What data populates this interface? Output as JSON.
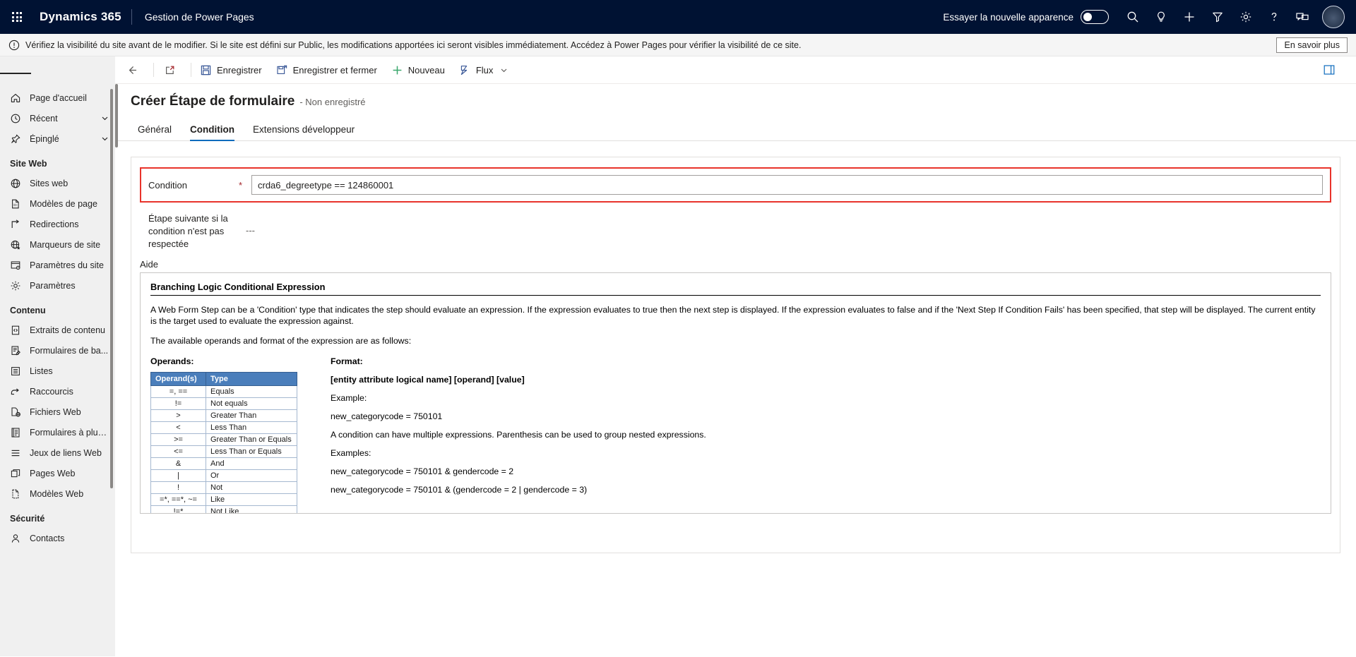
{
  "topnav": {
    "waffle_icon": "app-launcher-icon",
    "brand": "Dynamics 365",
    "app_name": "Gestion de Power Pages",
    "new_look_label": "Essayer la nouvelle apparence",
    "new_look_state": "off",
    "icons": [
      {
        "name": "search-icon"
      },
      {
        "name": "lightbulb-icon"
      },
      {
        "name": "plus-icon"
      },
      {
        "name": "filter-icon"
      },
      {
        "name": "gear-icon"
      },
      {
        "name": "help-question-icon"
      },
      {
        "name": "feedback-chat-icon"
      }
    ],
    "avatar": "user-avatar"
  },
  "notification": {
    "icon": "warning-circle-icon",
    "text": "Vérifiez la visibilité du site avant de le modifier. Si le site est défini sur Public, les modifications apportées ici seront visibles immédiatement. Accédez à Power Pages pour vérifier la visibilité de ce site.",
    "action_label": "En savoir plus"
  },
  "sidebar": {
    "hamburger": "site-map-toggle",
    "top_items": [
      {
        "label": "Page d'accueil",
        "icon": "home-icon",
        "chevron": false
      },
      {
        "label": "Récent",
        "icon": "clock-icon",
        "chevron": true
      },
      {
        "label": "Épinglé",
        "icon": "pin-icon",
        "chevron": true
      }
    ],
    "groups": [
      {
        "title": "Site Web",
        "items": [
          {
            "label": "Sites web",
            "icon": "globe-icon"
          },
          {
            "label": "Modèles de page",
            "icon": "page-template-icon"
          },
          {
            "label": "Redirections",
            "icon": "redirect-arrow-icon"
          },
          {
            "label": "Marqueurs de site",
            "icon": "globe-star-icon"
          },
          {
            "label": "Paramètres du site",
            "icon": "site-settings-icon"
          },
          {
            "label": "Paramètres",
            "icon": "gear-icon"
          }
        ]
      },
      {
        "title": "Contenu",
        "items": [
          {
            "label": "Extraits de contenu",
            "icon": "code-snippet-icon"
          },
          {
            "label": "Formulaires de ba...",
            "icon": "form-edit-icon"
          },
          {
            "label": "Listes",
            "icon": "list-icon"
          },
          {
            "label": "Raccourcis",
            "icon": "shortcut-icon"
          },
          {
            "label": "Fichiers Web",
            "icon": "web-file-icon"
          },
          {
            "label": "Formulaires à plus...",
            "icon": "multistep-form-icon"
          },
          {
            "label": "Jeux de liens Web",
            "icon": "link-set-icon"
          },
          {
            "label": "Pages Web",
            "icon": "web-pages-icon"
          },
          {
            "label": "Modèles Web",
            "icon": "web-template-icon"
          }
        ]
      },
      {
        "title": "Sécurité",
        "items": [
          {
            "label": "Contacts",
            "icon": "contact-person-icon"
          }
        ]
      }
    ]
  },
  "commandbar": {
    "back_icon": "back-arrow-icon",
    "popout_icon": "open-in-new-window-icon",
    "buttons": [
      {
        "label": "Enregistrer",
        "icon": "save-icon"
      },
      {
        "label": "Enregistrer et fermer",
        "icon": "save-and-close-icon"
      },
      {
        "label": "Nouveau",
        "icon": "plus-icon"
      },
      {
        "label": "Flux",
        "icon": "flow-icon",
        "chevron": true
      }
    ],
    "right_icon": "side-panel-icon"
  },
  "form": {
    "title": "Créer Étape de formulaire",
    "subtitle": "- Non enregistré",
    "tabs": [
      {
        "label": "Général",
        "active": false
      },
      {
        "label": "Condition",
        "active": true
      },
      {
        "label": "Extensions développeur",
        "active": false
      }
    ],
    "condition": {
      "label": "Condition",
      "required_marker": "*",
      "value": "crda6_degreetype == 124860001",
      "placeholder": ""
    },
    "next_step": {
      "label": "Étape suivante si la condition n'est pas respectée",
      "value": "---"
    },
    "help_section_label": "Aide"
  },
  "help": {
    "heading": "Branching Logic Conditional Expression",
    "paragraph1": "A Web Form Step can be a 'Condition' type that indicates the step should evaluate an expression. If the expression evaluates to true then the next step is displayed. If the expression evaluates to false and if the 'Next Step If Condition Fails' has been specified, that step will be displayed. The current entity is the target used to evaluate the expression against.",
    "paragraph2": "The available operands and format of the expression are as follows:",
    "operands_title": "Operands:",
    "operands_table": {
      "headers": [
        "Operand(s)",
        "Type"
      ],
      "rows": [
        [
          "=, ==",
          "Equals"
        ],
        [
          "!=",
          "Not equals"
        ],
        [
          ">",
          "Greater Than"
        ],
        [
          "<",
          "Less Than"
        ],
        [
          ">=",
          "Greater Than or Equals"
        ],
        [
          "<=",
          "Less Than or Equals"
        ],
        [
          "&",
          "And"
        ],
        [
          "|",
          "Or"
        ],
        [
          "!",
          "Not"
        ],
        [
          "=*, ==*, ~=",
          "Like"
        ],
        [
          "!=*",
          "Not Like"
        ]
      ]
    },
    "format_title": "Format:",
    "format_spec": "[entity attribute logical name] [operand] [value]",
    "example_label": "Example:",
    "example1": "new_categorycode = 750101",
    "multi_note": "A condition can have multiple expressions. Parenthesis can be used to group nested expressions.",
    "examples_label": "Examples:",
    "example2": "new_categorycode = 750101 & gendercode = 2",
    "example3": "new_categorycode = 750101 & (gendercode = 2 | gendercode = 3)"
  },
  "colors": {
    "nav_bg": "#001233",
    "accent_blue": "#0f6cbd",
    "required_red": "#a4262c",
    "highlight_red": "#e8332b",
    "table_header_blue": "#4a7ebb",
    "sidebar_bg": "#f0f0f0"
  }
}
